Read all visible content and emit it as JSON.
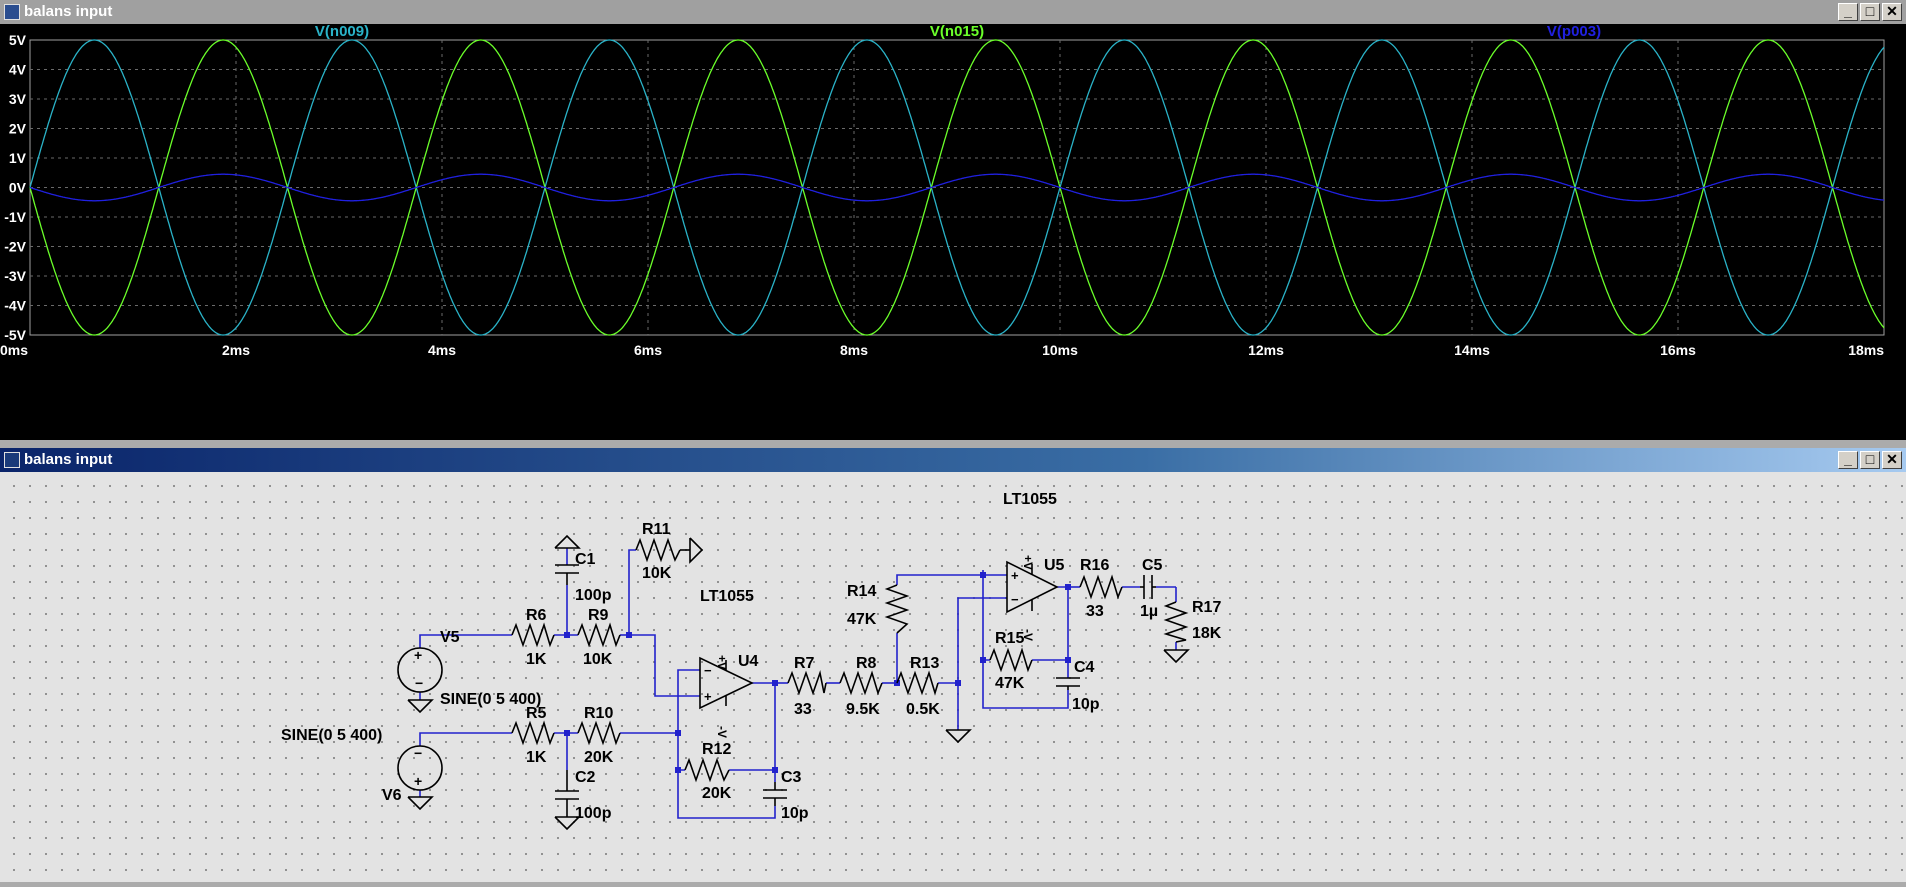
{
  "plot_window": {
    "title": "balans input",
    "controls": [
      "_",
      "□",
      "✕"
    ]
  },
  "schematic_window": {
    "title": "balans input",
    "controls": [
      "_",
      "□",
      "✕"
    ]
  },
  "colors": {
    "v_n009": "#2ab3c8",
    "v_n015": "#6bff2a",
    "v_p003": "#2020e0",
    "wire": "#2222cc",
    "component": "#000000"
  },
  "chart_data": {
    "type": "line",
    "title": "",
    "xlabel": "",
    "ylabel": "",
    "xlim": [
      0,
      18
    ],
    "ylim": [
      -5,
      5
    ],
    "x_unit": "ms",
    "y_unit": "V",
    "x_ticks": [
      "0ms",
      "2ms",
      "4ms",
      "6ms",
      "8ms",
      "10ms",
      "12ms",
      "14ms",
      "16ms",
      "18ms"
    ],
    "y_ticks": [
      "5V",
      "4V",
      "3V",
      "2V",
      "1V",
      "0V",
      "-1V",
      "-2V",
      "-3V",
      "-4V",
      "-5V"
    ],
    "grid": true,
    "series": [
      {
        "name": "V(n009)",
        "frequency_hz": 400,
        "amplitude": 5,
        "phase_sign": 1
      },
      {
        "name": "V(n015)",
        "frequency_hz": 400,
        "amplitude": 5,
        "phase_sign": -1
      },
      {
        "name": "V(p003)",
        "frequency_hz": 400,
        "amplitude": 0.45,
        "phase_sign": -1
      }
    ]
  },
  "schematic": {
    "labels": {
      "lt1055_top": "LT1055",
      "lt1055_u4": "LT1055",
      "c1": "C1",
      "c1_val": "100p",
      "r11": "R11",
      "r11_val": "10K",
      "r6": "R6",
      "r6_val": "1K",
      "r9": "R9",
      "r9_val": "10K",
      "v5": "V5",
      "sine1": "SINE(0 5 400)",
      "sine2": "SINE(0 5 400)",
      "r5": "R5",
      "r5_val": "1K",
      "r10": "R10",
      "r10_val": "20K",
      "c2": "C2",
      "c2_val": "100p",
      "v6": "V6",
      "u4": "U4",
      "r7": "R7",
      "r7_val": "33",
      "r8": "R8",
      "r8_val": "9.5K",
      "r13": "R13",
      "r13_val": "0.5K",
      "r12": "R12",
      "r12_val": "20K",
      "c3": "C3",
      "c3_val": "10p",
      "r14": "R14",
      "r14_val": "47K",
      "u5": "U5",
      "r16": "R16",
      "r16_val": "33",
      "c5": "C5",
      "c5_val": "1µ",
      "r17": "R17",
      "r17_val": "18K",
      "r15": "R15",
      "r15_val": "47K",
      "c4": "C4",
      "c4_val": "10p"
    }
  }
}
